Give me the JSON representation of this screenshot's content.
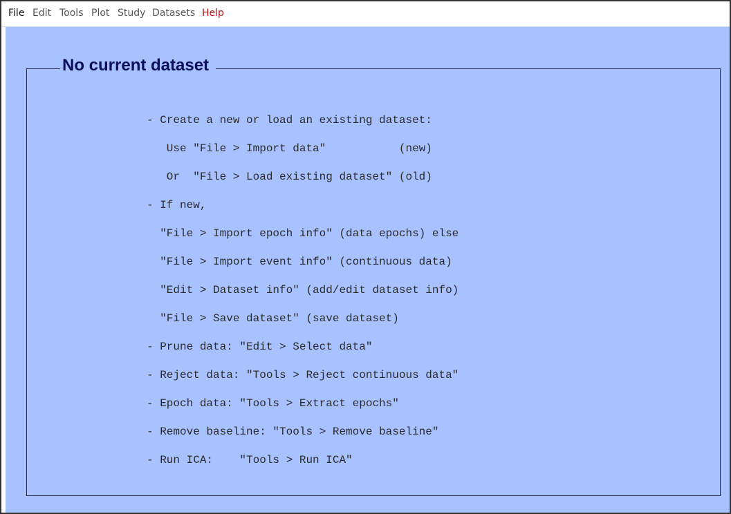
{
  "menubar": {
    "items": [
      "File",
      "Edit",
      "Tools",
      "Plot",
      "Study",
      "Datasets",
      "Help"
    ]
  },
  "panel": {
    "title": "No current dataset",
    "lines": [
      "- Create a new or load an existing dataset:",
      "   Use \"File > Import data\"           (new)",
      "   Or  \"File > Load existing dataset\" (old)",
      "- If new,",
      "  \"File > Import epoch info\" (data epochs) else",
      "  \"File > Import event info\" (continuous data)",
      "  \"Edit > Dataset info\" (add/edit dataset info)",
      "  \"File > Save dataset\" (save dataset)",
      "- Prune data: \"Edit > Select data\"",
      "- Reject data: \"Tools > Reject continuous data\"",
      "- Epoch data: \"Tools > Extract epochs\"",
      "- Remove baseline: \"Tools > Remove baseline\"",
      "- Run ICA:    \"Tools > Run ICA\""
    ]
  },
  "colors": {
    "panel_background": "#a8c1ff",
    "title_color": "#0a0f5c",
    "help_menu_color": "#b0141a"
  }
}
